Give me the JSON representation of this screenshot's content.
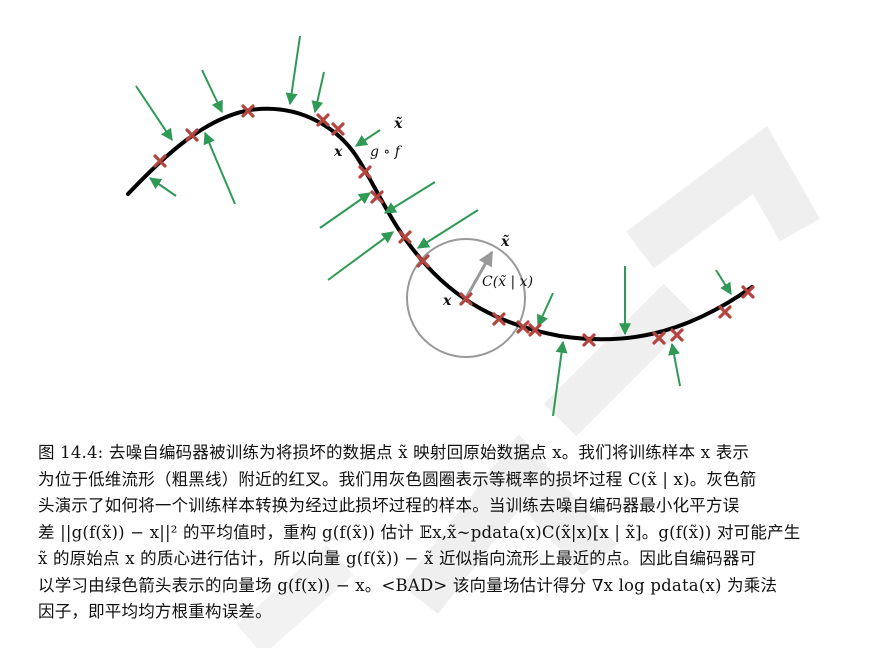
{
  "figure": {
    "labels": {
      "x_tilde_top": "x̃",
      "x_left_top": "x",
      "g_of_f": "g ∘ f",
      "x_tilde_circle": "x̃",
      "corruption": "C(x̃ | x)",
      "x_circle": "x"
    },
    "colors": {
      "manifold": "#000000",
      "cross": "#b5443e",
      "arrow_green": "#2e9a55",
      "arrow_gray": "#999999",
      "circle": "#999999"
    }
  },
  "caption": {
    "lines": [
      "图 14.4: 去噪自编码器被训练为将损坏的数据点 x̃ 映射回原始数据点 x。我们将训练样本 x 表示",
      "为位于低维流形（粗黑线）附近的红叉。我们用灰色圆圈表示等概率的损坏过程 C(x̃ | x)。灰色箭",
      "头演示了如何将一个训练样本转换为经过此损坏过程的样本。当训练去噪自编码器最小化平方误",
      "差 ||g(f(x̃)) − x||² 的平均值时，重构 g(f(x̃)) 估计 𝔼x,x̃∼pdata(x)C(x̃|x)[x | x̃]。g(f(x̃)) 对可能产生",
      "x̃ 的原始点 x 的质心进行估计，所以向量 g(f(x̃)) − x̃ 近似指向流形上最近的点。因此自编码器可",
      "以学习由绿色箭头表示的向量场 g(f(x)) − x。<BAD> 该向量场估计得分 ∇x log pdata(x) 为乘法",
      "因子，即平均均方根重构误差。"
    ]
  }
}
